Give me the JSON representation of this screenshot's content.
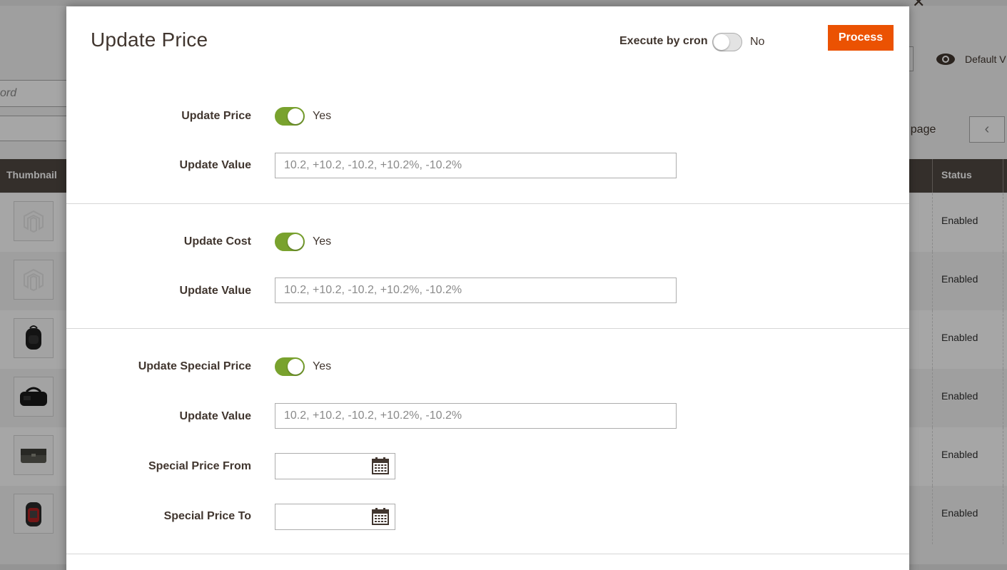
{
  "background": {
    "search_partial": "ord",
    "default_view": "Default V",
    "per_page_partial": "r page",
    "grid_headers": {
      "thumbnail": "Thumbnail",
      "status": "Status"
    },
    "rows": [
      {
        "status": "Enabled",
        "thumb": "placeholder-icon"
      },
      {
        "status": "Enabled",
        "thumb": "placeholder-icon"
      },
      {
        "status": "Enabled",
        "thumb": "backpack-icon"
      },
      {
        "status": "Enabled",
        "thumb": "duffle-bag-icon"
      },
      {
        "status": "Enabled",
        "thumb": "messenger-bag-icon"
      },
      {
        "status": "Enabled",
        "thumb": "backpack-red-icon"
      }
    ]
  },
  "modal": {
    "title": "Update Price",
    "execute_by_cron": {
      "label": "Execute by cron",
      "value": "No",
      "enabled": false
    },
    "process_label": "Process",
    "sections": {
      "price": {
        "toggle_label": "Update Price",
        "toggle_value": "Yes",
        "value_label": "Update Value",
        "value_placeholder": "10.2, +10.2, -10.2, +10.2%, -10.2%"
      },
      "cost": {
        "toggle_label": "Update Cost",
        "toggle_value": "Yes",
        "value_label": "Update Value",
        "value_placeholder": "10.2, +10.2, -10.2, +10.2%, -10.2%"
      },
      "special_price": {
        "toggle_label": "Update Special Price",
        "toggle_value": "Yes",
        "value_label": "Update Value",
        "value_placeholder": "10.2, +10.2, -10.2, +10.2%, -10.2%",
        "from_label": "Special Price From",
        "to_label": "Special Price To"
      }
    }
  },
  "colors": {
    "accent": "#eb5202",
    "toggle_on": "#79a22e",
    "grid_header": "#514943",
    "text_dark": "#41362f"
  }
}
